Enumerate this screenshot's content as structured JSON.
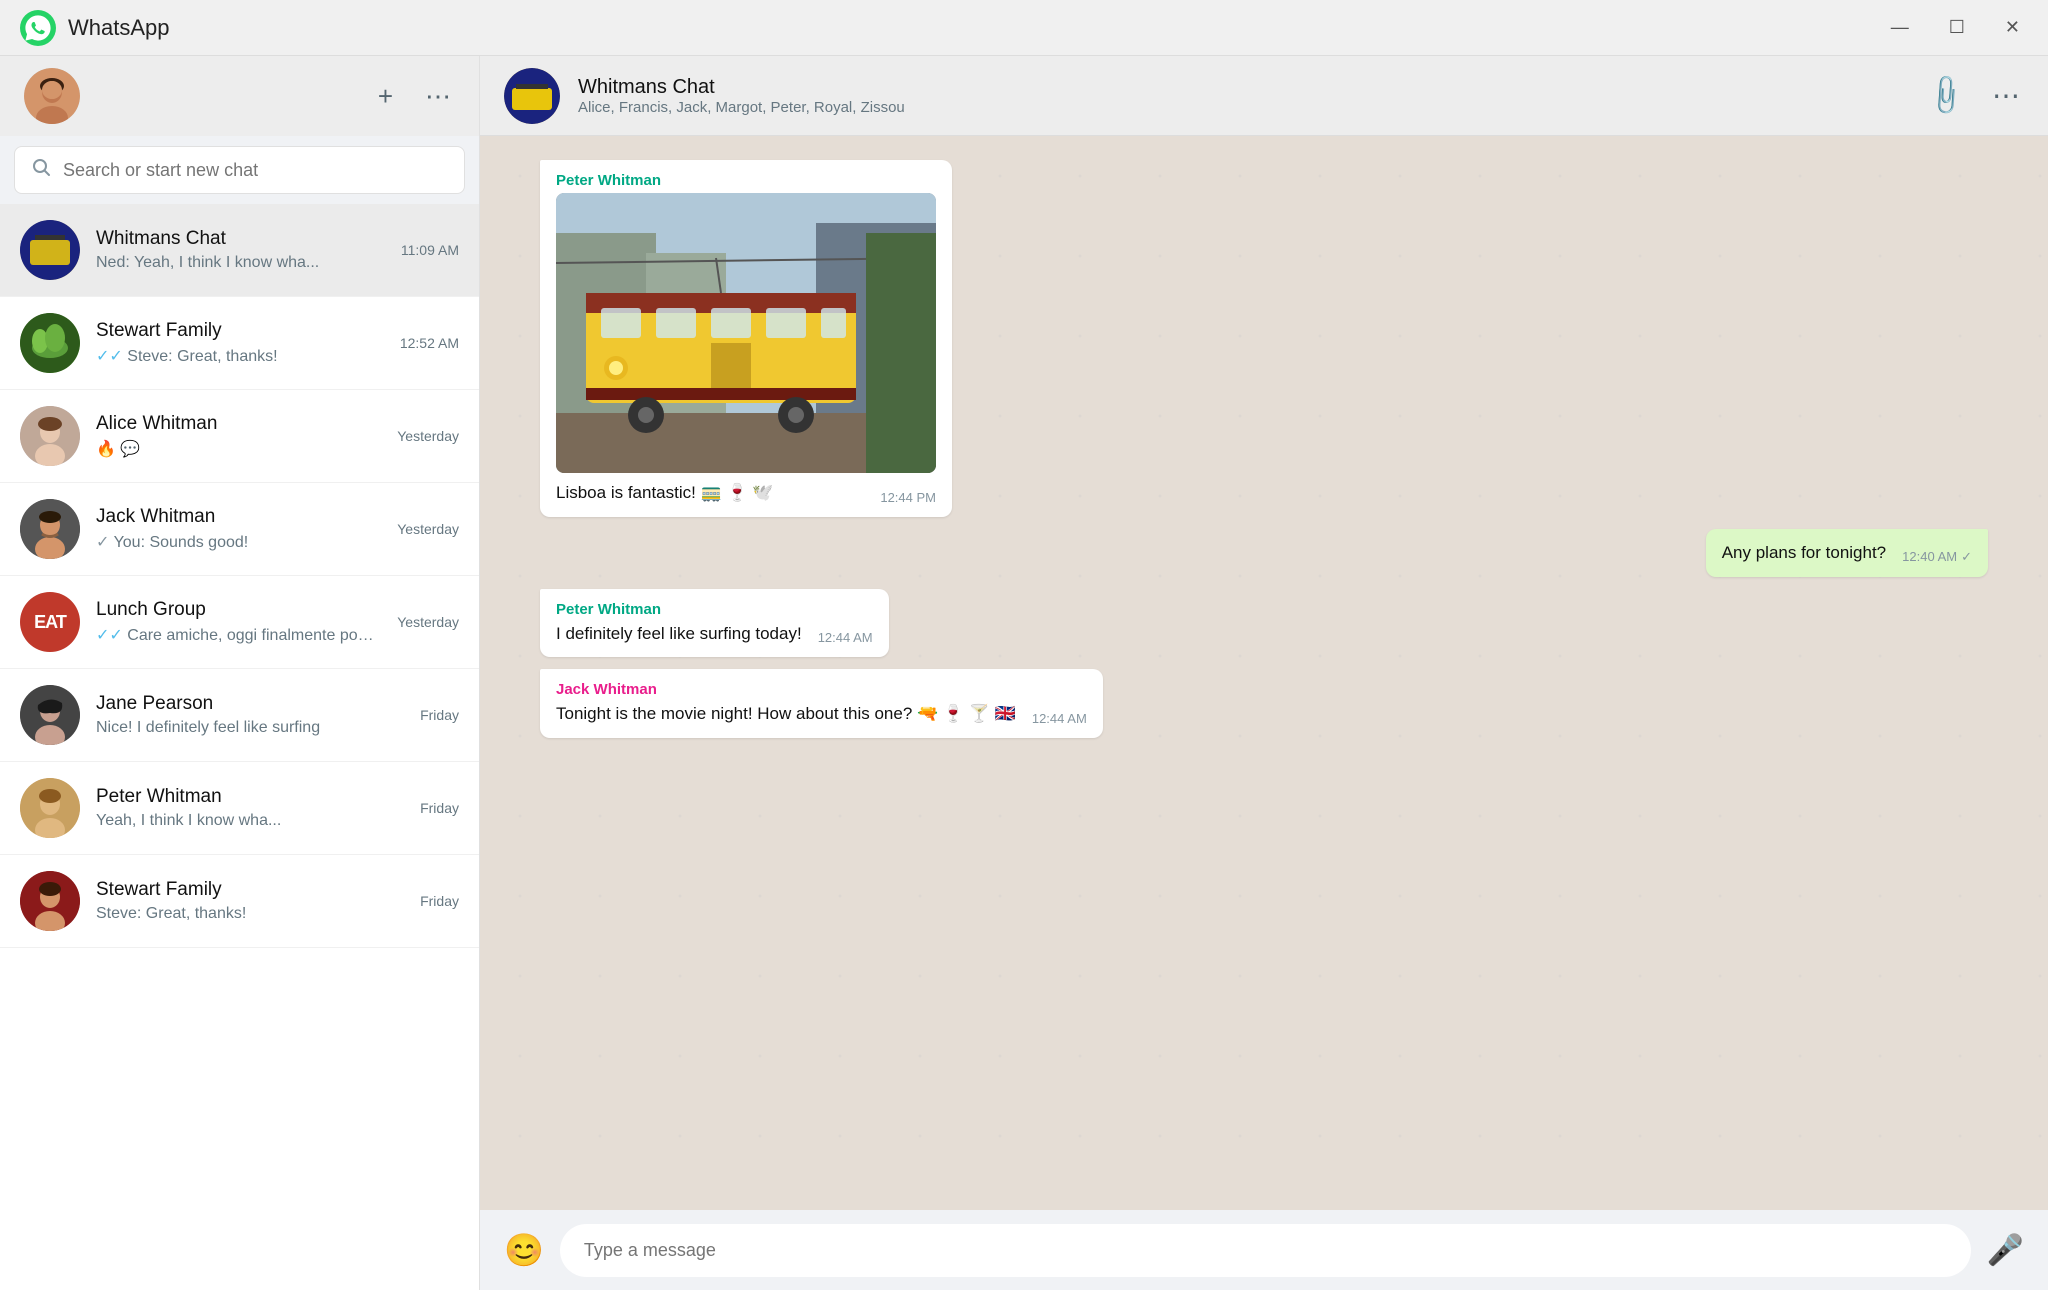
{
  "titlebar": {
    "title": "WhatsApp",
    "min_btn": "—",
    "max_btn": "☐",
    "close_btn": "✕"
  },
  "sidebar": {
    "user_avatar_text": "👤",
    "new_chat_icon": "+",
    "menu_icon": "⋯",
    "search_placeholder": "Search or start new chat",
    "chats": [
      {
        "id": "whitmans",
        "name": "Whitmans Chat",
        "preview": "Ned: Yeah, I think I know wha...",
        "time": "11:09 AM",
        "avatar_class": "av-whitmans",
        "avatar_text": "🏠"
      },
      {
        "id": "stewart-family",
        "name": "Stewart Family",
        "preview": "✔✔ Steve: Great, thanks!",
        "time": "12:52 AM",
        "avatar_class": "av-stewart",
        "avatar_text": "🌿"
      },
      {
        "id": "alice",
        "name": "Alice Whitman",
        "preview": "🔥 💬",
        "time": "Yesterday",
        "avatar_class": "av-alice",
        "avatar_text": "👩"
      },
      {
        "id": "jack",
        "name": "Jack Whitman",
        "preview": "✔ You: Sounds good!",
        "time": "Yesterday",
        "avatar_class": "av-jack",
        "avatar_text": "🧔"
      },
      {
        "id": "lunch",
        "name": "Lunch Group",
        "preview": "✔✔ Care amiche, oggi finalmente posso",
        "time": "Yesterday",
        "avatar_class": "av-lunch",
        "avatar_text": "EAT"
      },
      {
        "id": "jane",
        "name": "Jane Pearson",
        "preview": "Nice! I definitely feel like surfing",
        "time": "Friday",
        "avatar_class": "av-jane",
        "avatar_text": "👩"
      },
      {
        "id": "peter",
        "name": "Peter Whitman",
        "preview": "Yeah, I think I know wha...",
        "time": "Friday",
        "avatar_class": "av-peter",
        "avatar_text": "😊"
      },
      {
        "id": "stewart2",
        "name": "Stewart Family",
        "preview": "Steve: Great, thanks!",
        "time": "Friday",
        "avatar_class": "av-stewart2",
        "avatar_text": "👨"
      }
    ]
  },
  "chat": {
    "name": "Whitmans Chat",
    "members": "Alice, Francis, Jack, Margot, Peter, Royal, Zissou",
    "header_avatar_text": "🏠",
    "attach_icon": "📎",
    "menu_icon": "⋯",
    "messages": [
      {
        "id": "m1",
        "type": "incoming",
        "sender": "Peter Whitman",
        "sender_class": "peter",
        "has_image": true,
        "text": "Lisboa is fantastic! 🚃 🍷 🕊️",
        "time": "12:44 PM"
      },
      {
        "id": "m2",
        "type": "outgoing",
        "sender": "",
        "text": "Any plans for tonight?",
        "time": "12:40 AM",
        "show_check": true
      },
      {
        "id": "m3",
        "type": "incoming",
        "sender": "Peter Whitman",
        "sender_class": "peter",
        "text": "I definitely feel like surfing today!",
        "time": "12:44 AM"
      },
      {
        "id": "m4",
        "type": "incoming",
        "sender": "Jack Whitman",
        "sender_class": "jack",
        "text": "Tonight is the movie night! How about this one? 🔫 🍷 🍸 🇬🇧",
        "time": "12:44 AM"
      }
    ],
    "input_placeholder": "Type a message",
    "emoji_icon": "😊",
    "mic_icon": "🎤"
  }
}
